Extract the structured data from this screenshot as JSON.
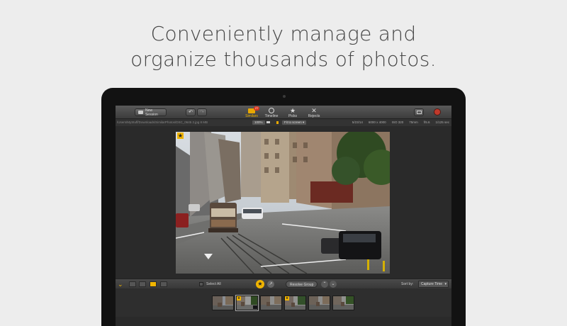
{
  "headline": {
    "line1": "Conveniently manage and",
    "line2": "organize thousands of photos."
  },
  "toolbar": {
    "new_session": "New Session",
    "similars_label": "Similars",
    "similars_badge": "27",
    "timeline_label": "Timeline",
    "picks_label": "Picks",
    "rejects_label": "Rejects"
  },
  "infobar": {
    "path": "/Users/MyStuff/Downloads/SimilarPhotos/DSC_0645 2.jpg",
    "size": "8 MB",
    "zoom": "100%",
    "fit": "Fit to screen",
    "date": "5/23/14",
    "dimensions": "6000 x 4000",
    "iso": "ISO 320",
    "focal": "75mm",
    "aperture": "f/5.6",
    "shutter": "1/125 sec"
  },
  "bottombar": {
    "select_all": "Select All",
    "resolve_group": "Resolve Group",
    "sort_by": "Sort by:",
    "sort_value": "Capture Time"
  },
  "colors": {
    "accent": "#f0b400",
    "badge": "#d9341e"
  }
}
